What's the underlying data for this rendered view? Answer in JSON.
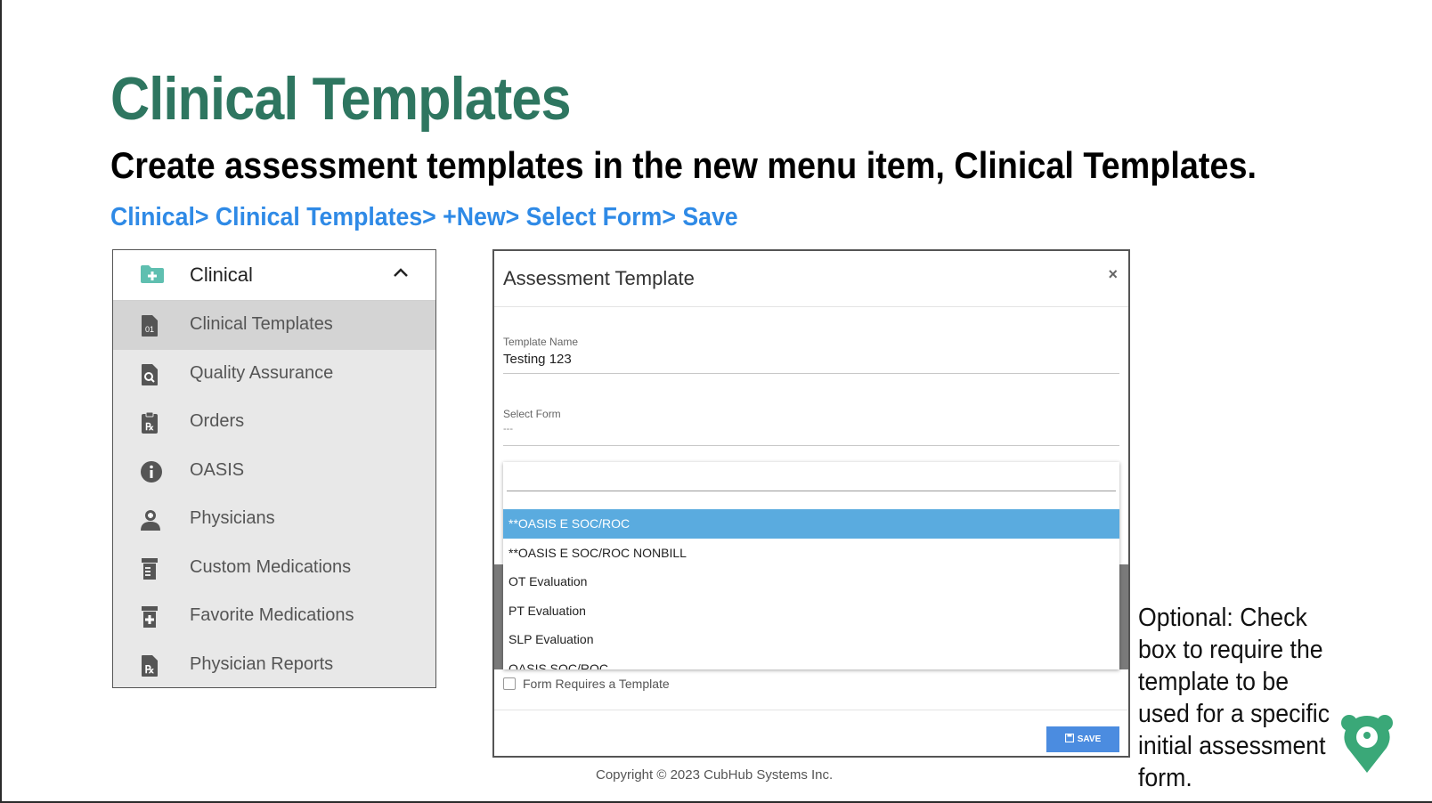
{
  "slide": {
    "title": "Clinical Templates",
    "subtitle": "Create assessment templates in the new menu item, Clinical Templates.",
    "path": "Clinical> Clinical Templates> +New> Select Form> Save",
    "note": "Optional: Check box to require the template to be used for a specific initial assessment form.",
    "copyright": "Copyright © 2023 CubHub Systems Inc."
  },
  "menu": {
    "header": {
      "label": "Clinical",
      "icon": "folder-plus-icon"
    },
    "items": [
      {
        "label": "Clinical Templates",
        "icon": "document-01-icon",
        "active": true
      },
      {
        "label": "Quality Assurance",
        "icon": "document-search-icon"
      },
      {
        "label": "Orders",
        "icon": "clipboard-rx-icon"
      },
      {
        "label": "OASIS",
        "icon": "info-circle-icon"
      },
      {
        "label": "Physicians",
        "icon": "physician-icon"
      },
      {
        "label": "Custom Medications",
        "icon": "pill-bottle-icon"
      },
      {
        "label": "Favorite Medications",
        "icon": "pill-bottle-plus-icon"
      },
      {
        "label": "Physician Reports",
        "icon": "document-rx-icon"
      }
    ]
  },
  "dialog": {
    "title": "Assessment Template",
    "close": "×",
    "template_name_label": "Template Name",
    "template_name_value": "Testing 123",
    "select_form_label": "Select Form",
    "select_form_value": "---",
    "options": [
      "**OASIS E SOC/ROC",
      "**OASIS E SOC/ROC NONBILL",
      "OT Evaluation",
      "PT Evaluation",
      "SLP Evaluation",
      "OASIS SOC/ROC"
    ],
    "selected_option": "**OASIS E SOC/ROC",
    "checkbox_label": "Form Requires a Template",
    "save_label": "SAVE"
  },
  "colors": {
    "title": "#2e7660",
    "path": "#2f8ae6",
    "selected": "#5aabdf",
    "save_button": "#4b8ce0"
  }
}
